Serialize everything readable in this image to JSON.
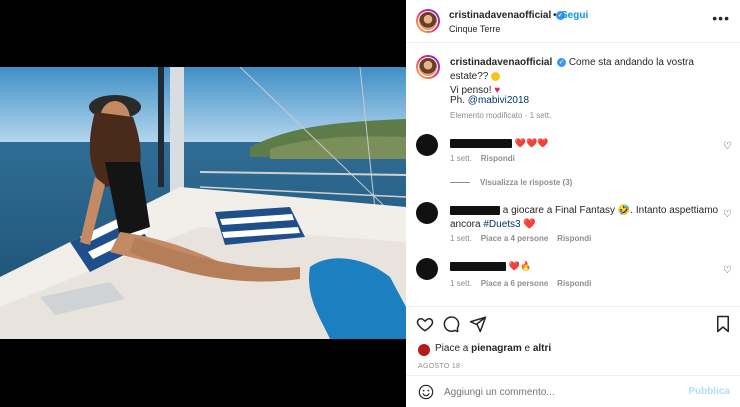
{
  "post": {
    "username": "cristinadavenaofficial",
    "follow_label": "Segui",
    "separator": "•",
    "location": "Cinque Terre",
    "more_label": "•••",
    "verified_icon": "✓"
  },
  "caption": {
    "username": "cristinadavenaofficial",
    "text_line1": "Come sta andando la vostra estate??",
    "text_line2": "Vi penso!",
    "photo_credit_prefix": "Ph.",
    "photo_credit_handle": "@mabivi2018",
    "meta": "Elemento modificato · 1 sett."
  },
  "comments": [
    {
      "text": "❤️❤️❤️",
      "time": "1 sett.",
      "reply_label": "Rispondi",
      "view_replies": "Visualizza le risposte (3)"
    },
    {
      "text_visible": "a giocare a Final Fantasy 🤣. Intanto aspettiamo",
      "text_line2_prefix": "ancora",
      "hashtag": "#Duets3",
      "heart": "❤️",
      "time": "1 sett.",
      "likes_label": "Piace a 4 persone",
      "reply_label": "Rispondi"
    },
    {
      "text": "❤️🔥",
      "time": "1 sett.",
      "likes_label": "Piace a 6 persone",
      "reply_label": "Rispondi"
    }
  ],
  "likes": {
    "prefix": "Piace a",
    "user": "pienagram",
    "conj": "e",
    "others": "altri"
  },
  "date": "AGOSTO 18",
  "add_comment": {
    "placeholder": "Aggiungi un commento...",
    "publish_label": "Pubblica"
  },
  "colors": {
    "accent": "#0095f6",
    "verified": "#3897f0",
    "muted": "#8e8e8e",
    "publish_disabled": "#b2dffc"
  }
}
